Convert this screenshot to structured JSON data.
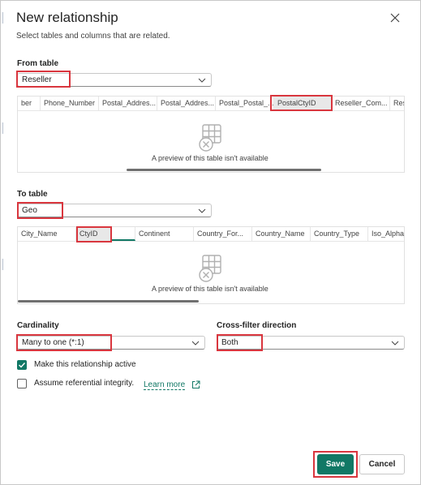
{
  "dialog": {
    "title": "New relationship",
    "subtitle": "Select tables and columns that are related."
  },
  "from_table": {
    "label": "From table",
    "selected": "Reseller",
    "columns": [
      "ber",
      "Phone_Number",
      "Postal_Addres...",
      "Postal_Addres...",
      "Postal_Postal_...",
      "PostalCtyID",
      "Reseller_Com...",
      "Res"
    ],
    "selected_column": "PostalCtyID",
    "preview_text": "A preview of this table isn't available"
  },
  "to_table": {
    "label": "To table",
    "selected": "Geo",
    "columns": [
      "City_Name",
      "CtyID",
      "",
      "Continent",
      "Country_For...",
      "Country_Name",
      "Country_Type",
      "Iso_Alpha_"
    ],
    "selected_column": "CtyID",
    "preview_text": "A preview of this table isn't available"
  },
  "cardinality": {
    "label": "Cardinality",
    "selected": "Many to one (*:1)"
  },
  "cross_filter": {
    "label": "Cross-filter direction",
    "selected": "Both"
  },
  "options": {
    "active_label": "Make this relationship active",
    "active_checked": true,
    "integrity_label": "Assume referential integrity.",
    "integrity_checked": false,
    "learn_more": "Learn more"
  },
  "buttons": {
    "save": "Save",
    "cancel": "Cancel"
  },
  "colors": {
    "accent": "#117865",
    "highlight": "#d9363e"
  },
  "icons": [
    "close-icon",
    "chevron-down-icon",
    "table-preview-icon",
    "checkmark-icon",
    "external-link-icon"
  ]
}
